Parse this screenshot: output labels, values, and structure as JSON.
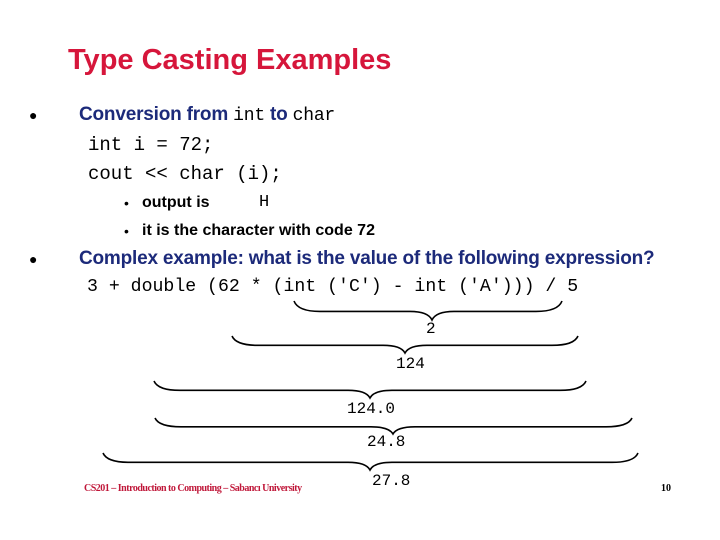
{
  "slide": {
    "title": "Type Casting Examples",
    "bullets": [
      {
        "text_before": "Conversion from ",
        "code1": "int",
        "text_mid": " to ",
        "code2": "char",
        "code_lines": [
          "int i = 72;",
          "cout << char (i);"
        ],
        "sub_bullets": [
          {
            "label": "output is",
            "code": "H"
          },
          {
            "label": "it is the character with code 72"
          }
        ]
      },
      {
        "text": "Complex example: what is the value of the following expression?",
        "expression": "3 + double (62 * (int ('C') - int ('A'))) / 5",
        "evaluation_steps": [
          "2",
          "124",
          "124.0",
          "24.8",
          "27.8"
        ]
      }
    ],
    "bullet_glyph": "●",
    "sub_bullet_glyph": "•",
    "footer": "CS201 – Introduction to Computing – Sabancı University",
    "page_number": "10",
    "colors": {
      "title": "#d6163b",
      "bullet_text": "#1c2a7a",
      "footer": "#c0183a"
    }
  }
}
